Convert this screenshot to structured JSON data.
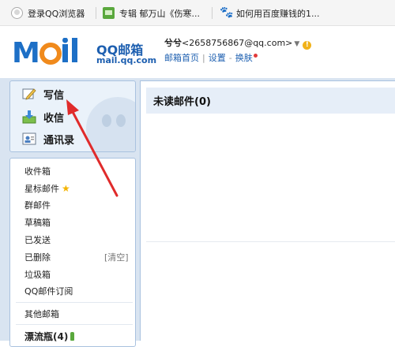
{
  "browser": {
    "bookmarks": [
      {
        "label": "登录QQ浏览器",
        "icon": "user-avatar-icon"
      },
      {
        "label": "专辑 郁万山《伤寒...",
        "icon": "green-book-icon"
      },
      {
        "label": "如何用百度赚钱的1...",
        "icon": "baidu-paw-icon"
      }
    ]
  },
  "header": {
    "logo_text": "Mail",
    "brand_cn": "QQ邮箱",
    "brand_domain": "mail.qq.com",
    "account_name": "兮兮",
    "account_email": "<2658756867@qq.com>",
    "account_badge": "!",
    "links": {
      "home": "邮箱首页",
      "settings": "设置",
      "skin": "换肤"
    }
  },
  "sidebar": {
    "actions": {
      "write": "写信",
      "receive": "收信",
      "contacts": "通讯录"
    },
    "folders": {
      "inbox": "收件箱",
      "starred": "星标邮件",
      "group": "群邮件",
      "drafts": "草稿箱",
      "sent": "已发送",
      "deleted": "已删除",
      "deleted_clear": "[清空]",
      "trash": "垃圾箱",
      "subscriptions": "QQ邮件订阅",
      "other": "其他邮箱",
      "drift_bottle": "漂流瓶(4)"
    }
  },
  "main": {
    "title": "未读邮件(0)"
  },
  "colors": {
    "brand_blue": "#1d5fb0",
    "logo_orange": "#f08a1c",
    "annotation_red": "#e02b2b"
  }
}
